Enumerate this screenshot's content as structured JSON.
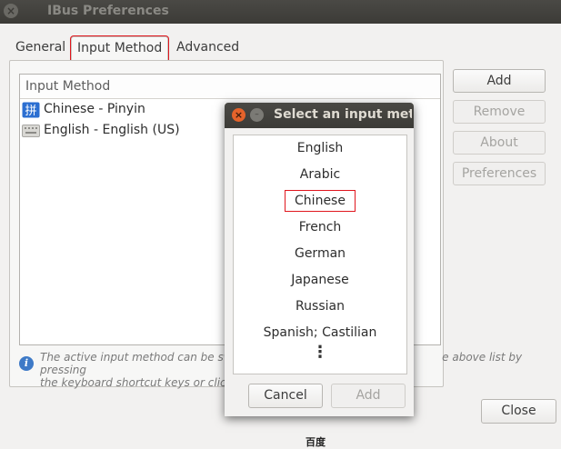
{
  "window": {
    "title": "IBus Preferences",
    "close_glyph": "×"
  },
  "tabs": [
    {
      "label": "General"
    },
    {
      "label": "Input Method"
    },
    {
      "label": "Advanced"
    }
  ],
  "input_list": {
    "header": "Input Method",
    "items": [
      {
        "label": "Chinese - Pinyin",
        "icon": "pinyin-icon",
        "glyph": "拼"
      },
      {
        "label": "English - English (US)",
        "icon": "keyboard-icon"
      }
    ]
  },
  "side_buttons": {
    "add": "Add",
    "remove": "Remove",
    "about": "About",
    "preferences": "Preferences"
  },
  "info": {
    "icon_glyph": "i",
    "text_line1": "The active input method can be switc",
    "text_line1_end": "e above list by pressing",
    "text_line2": "the keyboard shortcut keys or clicking"
  },
  "close_button": "Close",
  "dialog": {
    "title": "Select an input meth",
    "close_glyph": "×",
    "min_glyph": "–",
    "languages": [
      "English",
      "Arabic",
      "Chinese",
      "French",
      "German",
      "Japanese",
      "Russian",
      "Spanish; Castilian"
    ],
    "selected": "Chinese",
    "more_glyph": "⋮",
    "cancel": "Cancel",
    "add": "Add"
  },
  "footer": "百度",
  "colors": {
    "highlight": "#e0161d",
    "titlebar": "#3c3b37",
    "dialog_close": "#e5632b",
    "info": "#3e7ac7"
  }
}
